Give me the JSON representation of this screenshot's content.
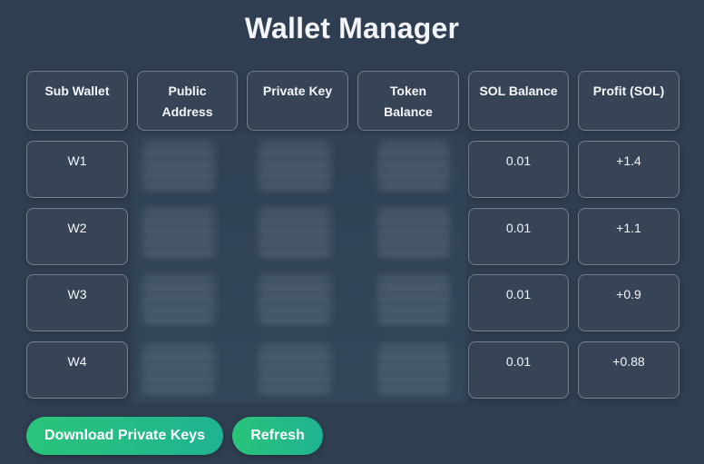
{
  "title": "Wallet Manager",
  "table": {
    "headers": {
      "sub_wallet": "Sub Wallet",
      "public_address_line1": "Public",
      "public_address_line2": "Address",
      "private_key": "Private Key",
      "token_balance_line1": "Token",
      "token_balance_line2": "Balance",
      "sol_balance": "SOL Balance",
      "profit": "Profit (SOL)"
    },
    "rows": [
      {
        "wallet": "W1",
        "sol_balance": "0.01",
        "profit": "+1.4"
      },
      {
        "wallet": "W2",
        "sol_balance": "0.01",
        "profit": "+1.1"
      },
      {
        "wallet": "W3",
        "sol_balance": "0.01",
        "profit": "+0.9"
      },
      {
        "wallet": "W4",
        "sol_balance": "0.01",
        "profit": "+0.88"
      }
    ]
  },
  "buttons": {
    "download_label": "Download Private Keys",
    "refresh_label": "Refresh"
  },
  "colors": {
    "background": "#2f3e50",
    "button_gradient_start": "#2ac47a",
    "button_gradient_end": "#1fb392"
  }
}
